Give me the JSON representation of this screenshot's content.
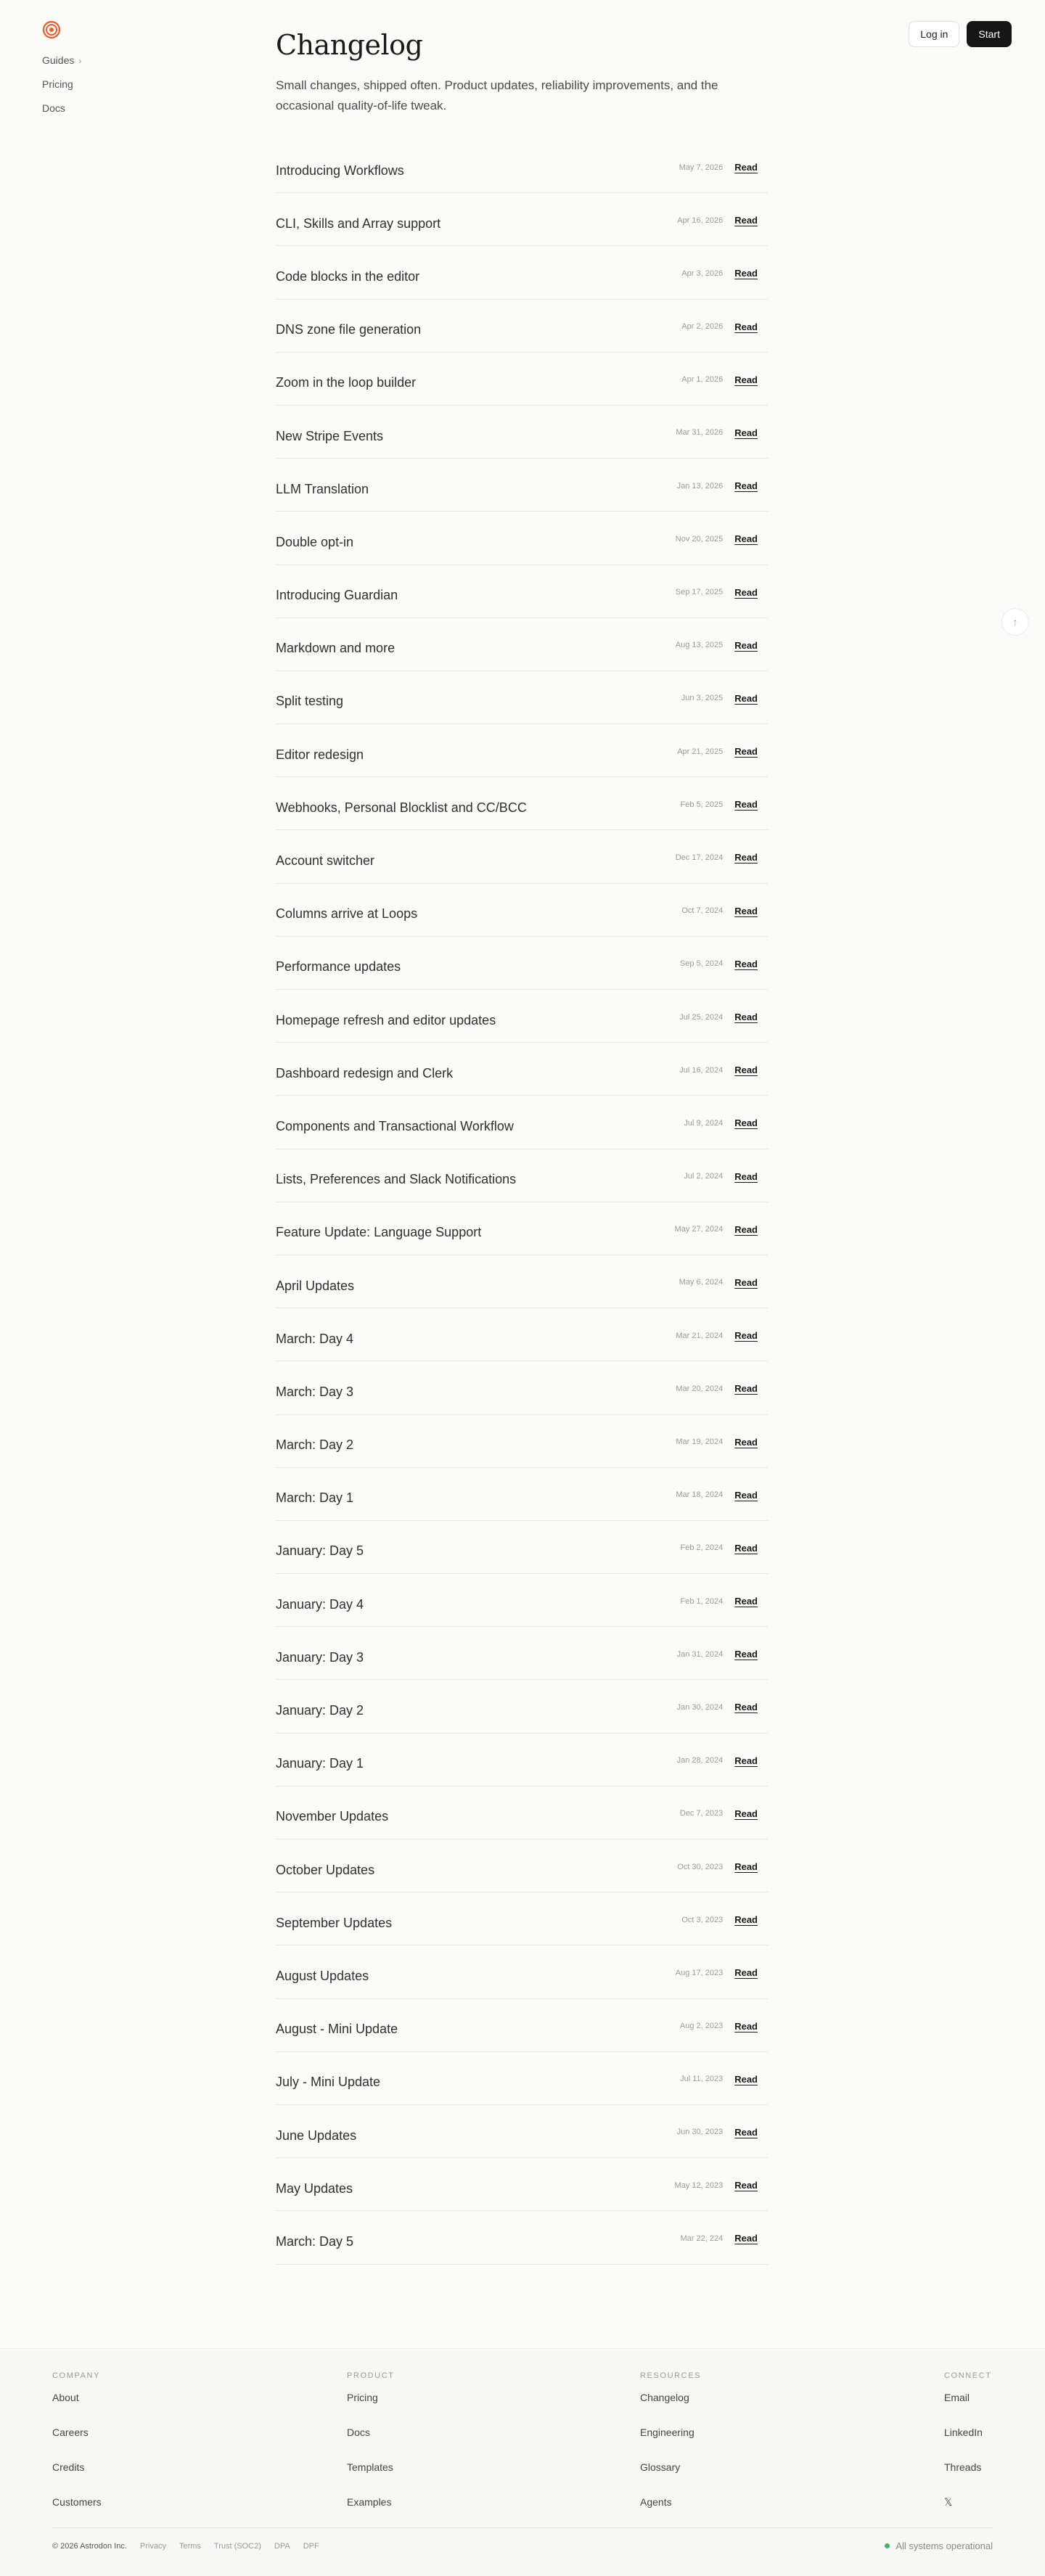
{
  "nav": {
    "items": [
      {
        "label": "Guides",
        "has_chevron": true
      },
      {
        "label": "Pricing"
      },
      {
        "label": "Docs"
      }
    ],
    "chevron": "›"
  },
  "header": {
    "login_label": "Log in",
    "start_label": "Start"
  },
  "page": {
    "title": "Changelog",
    "subtitle": "Small changes, shipped often. Product updates, reliability improvements, and the occasional quality-of-life tweak."
  },
  "read_label": "Read",
  "entries": [
    {
      "title": "Introducing Workflows",
      "date": "May 7, 2026"
    },
    {
      "title": "CLI, Skills and Array support",
      "date": "Apr 16, 2026"
    },
    {
      "title": "Code blocks in the editor",
      "date": "Apr 3, 2026"
    },
    {
      "title": "DNS zone file generation",
      "date": "Apr 2, 2026"
    },
    {
      "title": "Zoom in the loop builder",
      "date": "Apr 1, 2026"
    },
    {
      "title": "New Stripe Events",
      "date": "Mar 31, 2026"
    },
    {
      "title": "LLM Translation",
      "date": "Jan 13, 2026"
    },
    {
      "title": "Double opt-in",
      "date": "Nov 20, 2025"
    },
    {
      "title": "Introducing Guardian",
      "date": "Sep 17, 2025"
    },
    {
      "title": "Markdown and more",
      "date": "Aug 13, 2025"
    },
    {
      "title": "Split testing",
      "date": "Jun 3, 2025"
    },
    {
      "title": "Editor redesign",
      "date": "Apr 21, 2025"
    },
    {
      "title": "Webhooks, Personal Blocklist and CC/BCC",
      "date": "Feb 5, 2025"
    },
    {
      "title": "Account switcher",
      "date": "Dec 17, 2024"
    },
    {
      "title": "Columns arrive at Loops",
      "date": "Oct 7, 2024"
    },
    {
      "title": "Performance updates",
      "date": "Sep 5, 2024"
    },
    {
      "title": "Homepage refresh and editor updates",
      "date": "Jul 25, 2024"
    },
    {
      "title": "Dashboard redesign and Clerk",
      "date": "Jul 16, 2024"
    },
    {
      "title": "Components and Transactional Workflow",
      "date": "Jul 9, 2024"
    },
    {
      "title": "Lists, Preferences and Slack Notifications",
      "date": "Jul 2, 2024"
    },
    {
      "title": "Feature Update: Language Support",
      "date": "May 27, 2024"
    },
    {
      "title": "April Updates",
      "date": "May 6, 2024"
    },
    {
      "title": "March: Day 4",
      "date": "Mar 21, 2024"
    },
    {
      "title": "March: Day 3",
      "date": "Mar 20, 2024"
    },
    {
      "title": "March: Day 2",
      "date": "Mar 19, 2024"
    },
    {
      "title": "March: Day 1",
      "date": "Mar 18, 2024"
    },
    {
      "title": "January: Day 5",
      "date": "Feb 2, 2024"
    },
    {
      "title": "January: Day 4",
      "date": "Feb 1, 2024"
    },
    {
      "title": "January: Day 3",
      "date": "Jan 31, 2024"
    },
    {
      "title": "January: Day 2",
      "date": "Jan 30, 2024"
    },
    {
      "title": "January: Day 1",
      "date": "Jan 28, 2024"
    },
    {
      "title": "November Updates",
      "date": "Dec 7, 2023"
    },
    {
      "title": "October Updates",
      "date": "Oct 30, 2023"
    },
    {
      "title": "September Updates",
      "date": "Oct 3, 2023"
    },
    {
      "title": "August Updates",
      "date": "Aug 17, 2023"
    },
    {
      "title": "August - Mini Update",
      "date": "Aug 2, 2023"
    },
    {
      "title": "July - Mini Update",
      "date": "Jul 11, 2023"
    },
    {
      "title": "June Updates",
      "date": "Jun 30, 2023"
    },
    {
      "title": "May Updates",
      "date": "May 12, 2023"
    },
    {
      "title": "March: Day 5",
      "date": "Mar 22, 224"
    }
  ],
  "scroll_top_glyph": "↑",
  "footer": {
    "columns": [
      {
        "heading": "COMPANY",
        "links": [
          "About",
          "Careers",
          "Credits",
          "Customers"
        ]
      },
      {
        "heading": "PRODUCT",
        "links": [
          "Pricing",
          "Docs",
          "Templates",
          "Examples"
        ]
      },
      {
        "heading": "RESOURCES",
        "links": [
          "Changelog",
          "Engineering",
          "Glossary",
          "Agents"
        ]
      },
      {
        "heading": "CONNECT",
        "links": [
          "Email",
          "LinkedIn",
          "Threads",
          "𝕏"
        ]
      }
    ],
    "copyright": "© 2026 Astrodon Inc.",
    "legal_links": [
      "Privacy",
      "Terms",
      "Trust (SOC2)",
      "DPA",
      "DPF"
    ],
    "status_text": "All systems operational"
  },
  "colors": {
    "brand": "#f05a28",
    "status": "#3fb56b"
  }
}
